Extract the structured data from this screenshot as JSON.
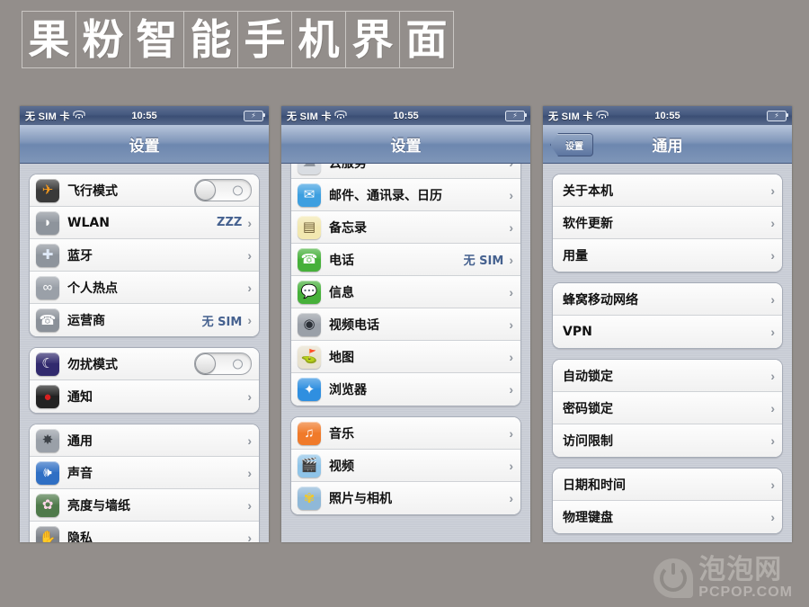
{
  "banner": {
    "title": "果粉智能手机界面",
    "characters": [
      "果",
      "粉",
      "智",
      "能",
      "手",
      "机",
      "界",
      "面"
    ]
  },
  "statusbar": {
    "carrier": "无 SIM 卡",
    "time": "10:55",
    "wifi_icon": "wifi-icon",
    "battery_icon": "battery-charging-icon",
    "battery_glyph": "⚡"
  },
  "colors": {
    "page_background": "#938e8b",
    "statusbar": "#43577e",
    "navbar": "#7f96b8",
    "value_text": "#45618f",
    "screen_background": "#c9cdd6"
  },
  "phones": [
    {
      "id": "phone-settings-top",
      "nav": {
        "title": "设置",
        "back_label": null
      },
      "scrolled": false,
      "groups": [
        {
          "clipped_top": false,
          "rows": [
            {
              "label": "飞行模式",
              "icon": "airplane-icon",
              "glyph": "✈",
              "icon_bg": "#3a3a3a",
              "icon_color": "#f59a1e",
              "control": "toggle",
              "toggle_on": false
            },
            {
              "label": "WLAN",
              "icon": "wifi-settings-icon",
              "glyph": "◗",
              "icon_bg": "#8e949c",
              "icon_color": "#ffffff",
              "control": "value",
              "value": "ZZZ"
            },
            {
              "label": "蓝牙",
              "icon": "bluetooth-icon",
              "glyph": "✚",
              "icon_bg": "#8e949c",
              "icon_color": "#dfe9f7",
              "control": "chevron"
            },
            {
              "label": "个人热点",
              "icon": "personal-hotspot-icon",
              "glyph": "∞",
              "icon_bg": "#9aa0a8",
              "icon_color": "#ffffff",
              "control": "chevron"
            },
            {
              "label": "运营商",
              "icon": "phone-carrier-icon",
              "glyph": "☎",
              "icon_bg": "#8b9199",
              "icon_color": "#ffffff",
              "control": "value",
              "value": "无 SIM"
            }
          ]
        },
        {
          "clipped_top": false,
          "rows": [
            {
              "label": "勿扰模式",
              "icon": "moon-icon",
              "glyph": "☾",
              "icon_bg": "#312a6e",
              "icon_color": "#ffffff",
              "control": "toggle",
              "toggle_on": false
            },
            {
              "label": "通知",
              "icon": "notifications-icon",
              "glyph": "●",
              "icon_bg": "#222222",
              "icon_color": "#d81f1f",
              "control": "chevron"
            }
          ]
        },
        {
          "clipped_top": false,
          "rows": [
            {
              "label": "通用",
              "icon": "general-gear-icon",
              "glyph": "✸",
              "icon_bg": "#9aa0a8",
              "icon_color": "#3d4248",
              "control": "chevron"
            },
            {
              "label": "声音",
              "icon": "sounds-icon",
              "glyph": "🕪",
              "icon_bg": "#2f6fc4",
              "icon_color": "#ffffff",
              "control": "chevron"
            },
            {
              "label": "亮度与墙纸",
              "icon": "brightness-wallpaper-icon",
              "glyph": "✿",
              "icon_bg": "#4f7a4a",
              "icon_color": "#ffd7ea",
              "control": "chevron"
            },
            {
              "label": "隐私",
              "icon": "privacy-hand-icon",
              "glyph": "✋",
              "icon_bg": "#7c8188",
              "icon_color": "#ffffff",
              "control": "chevron"
            }
          ]
        }
      ]
    },
    {
      "id": "phone-settings-scrolled",
      "nav": {
        "title": "设置",
        "back_label": null
      },
      "scrolled": true,
      "groups": [
        {
          "clipped_top": true,
          "rows": [
            {
              "label": "云服务",
              "icon": "icloud-icon",
              "glyph": "☁",
              "icon_bg": "#d9dde2",
              "icon_color": "#8f959d",
              "control": "chevron"
            },
            {
              "label": "邮件、通讯录、日历",
              "icon": "mail-icon",
              "glyph": "✉",
              "icon_bg": "#3d9fe0",
              "icon_color": "#ffffff",
              "control": "chevron"
            },
            {
              "label": "备忘录",
              "icon": "notes-icon",
              "glyph": "▤",
              "icon_bg": "#f2e8b0",
              "icon_color": "#6b5a33",
              "control": "chevron"
            },
            {
              "label": "电话",
              "icon": "phone-icon",
              "glyph": "☎",
              "icon_bg": "#46b03a",
              "icon_color": "#ffffff",
              "control": "value",
              "value": "无 SIM"
            },
            {
              "label": "信息",
              "icon": "messages-icon",
              "glyph": "💬",
              "icon_bg": "#46b03a",
              "icon_color": "#ffffff",
              "control": "chevron"
            },
            {
              "label": "视频电话",
              "icon": "facetime-icon",
              "glyph": "◉",
              "icon_bg": "#9aa0a8",
              "icon_color": "#2a2f36",
              "control": "chevron"
            },
            {
              "label": "地图",
              "icon": "maps-icon",
              "glyph": "⛳",
              "icon_bg": "#e8e2cf",
              "icon_color": "#3f7fc0",
              "control": "chevron"
            },
            {
              "label": "浏览器",
              "icon": "safari-icon",
              "glyph": "✦",
              "icon_bg": "#2f8fe0",
              "icon_color": "#ffffff",
              "control": "chevron"
            }
          ]
        },
        {
          "clipped_top": false,
          "rows": [
            {
              "label": "音乐",
              "icon": "music-icon",
              "glyph": "♫",
              "icon_bg": "#f07a2a",
              "icon_color": "#ffffff",
              "control": "chevron"
            },
            {
              "label": "视频",
              "icon": "videos-icon",
              "glyph": "🎬",
              "icon_bg": "#8fc4e8",
              "icon_color": "#20303c",
              "control": "chevron"
            },
            {
              "label": "照片与相机",
              "icon": "photos-camera-icon",
              "glyph": "✾",
              "icon_bg": "#8fb8d8",
              "icon_color": "#f2c82a",
              "control": "chevron"
            }
          ]
        }
      ]
    },
    {
      "id": "phone-general",
      "nav": {
        "title": "通用",
        "back_label": "设置"
      },
      "scrolled": false,
      "groups": [
        {
          "clipped_top": false,
          "rows": [
            {
              "label": "关于本机",
              "control": "chevron"
            },
            {
              "label": "软件更新",
              "control": "chevron"
            },
            {
              "label": "用量",
              "control": "chevron"
            }
          ]
        },
        {
          "clipped_top": false,
          "rows": [
            {
              "label": "蜂窝移动网络",
              "control": "chevron"
            },
            {
              "label": "VPN",
              "control": "chevron"
            }
          ]
        },
        {
          "clipped_top": false,
          "rows": [
            {
              "label": "自动锁定",
              "control": "chevron"
            },
            {
              "label": "密码锁定",
              "control": "chevron"
            },
            {
              "label": "访问限制",
              "control": "chevron"
            }
          ]
        },
        {
          "clipped_top": false,
          "rows": [
            {
              "label": "日期和时间",
              "control": "chevron"
            },
            {
              "label": "物理键盘",
              "control": "chevron"
            }
          ]
        }
      ]
    }
  ],
  "watermark": {
    "logo_icon": "power-logo-icon",
    "cn": "泡泡网",
    "en": "PCPOP.COM"
  }
}
